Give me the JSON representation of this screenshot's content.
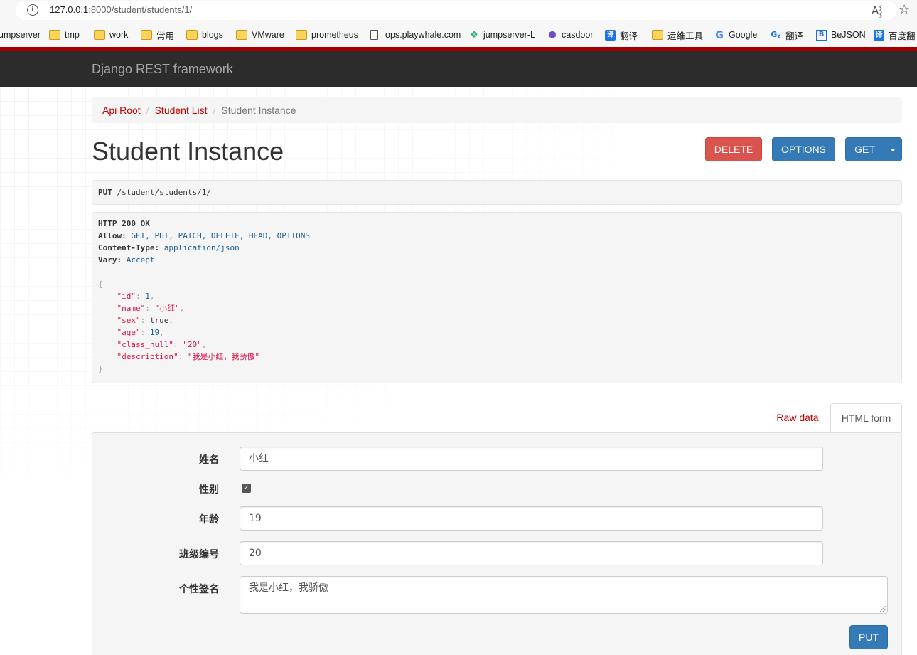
{
  "browser": {
    "url_host": "127.0.0.1",
    "url_rest": ":8000/student/students/1/",
    "bookmarks": [
      {
        "label": "umpserver",
        "icon": "none"
      },
      {
        "label": "tmp",
        "icon": "folder-icon"
      },
      {
        "label": "work",
        "icon": "folder-icon"
      },
      {
        "label": "常用",
        "icon": "folder-icon"
      },
      {
        "label": "blogs",
        "icon": "folder-icon"
      },
      {
        "label": "VMware",
        "icon": "folder-icon"
      },
      {
        "label": "prometheus",
        "icon": "folder-icon"
      },
      {
        "label": "ops.playwhale.com",
        "icon": "document-icon"
      },
      {
        "label": "jumpserver-L",
        "icon": "jumpserver-icon"
      },
      {
        "label": "casdoor",
        "icon": "cube-icon"
      },
      {
        "label": "翻译",
        "icon": "translate-icon"
      },
      {
        "label": "运维工具",
        "icon": "folder-icon"
      },
      {
        "label": "Google",
        "icon": "google-icon"
      },
      {
        "label": "翻译",
        "icon": "google-translate-icon"
      },
      {
        "label": "BeJSON",
        "icon": "bejson-icon"
      },
      {
        "label": "百度翻",
        "icon": "translate-icon"
      }
    ]
  },
  "navbar": {
    "brand": "Django REST framework",
    "accent_color": "#a30000"
  },
  "breadcrumb": {
    "items": [
      "Api Root",
      "Student List"
    ],
    "active": "Student Instance"
  },
  "page": {
    "title": "Student Instance",
    "buttons": {
      "delete": "DELETE",
      "options": "OPTIONS",
      "get": "GET"
    }
  },
  "request": {
    "method": "PUT",
    "path": "/student/students/1/"
  },
  "response": {
    "status": "HTTP 200 OK",
    "headers": [
      {
        "name": "Allow",
        "value": "GET, PUT, PATCH, DELETE, HEAD, OPTIONS"
      },
      {
        "name": "Content-Type",
        "value": "application/json"
      },
      {
        "name": "Vary",
        "value": "Accept"
      }
    ],
    "body": {
      "id": "1",
      "name": "\"小红\"",
      "sex": "true",
      "age": "19",
      "class_null": "\"20\"",
      "description": "\"我是小红，我骄傲\""
    }
  },
  "tabs": {
    "raw": "Raw data",
    "html": "HTML form"
  },
  "form": {
    "name_label": "姓名",
    "name_value": "小红",
    "sex_label": "性别",
    "sex_checked": true,
    "age_label": "年龄",
    "age_value": "19",
    "class_label": "班级编号",
    "class_value": "20",
    "desc_label": "个性签名",
    "desc_value": "我是小红，我骄傲",
    "submit": "PUT"
  }
}
